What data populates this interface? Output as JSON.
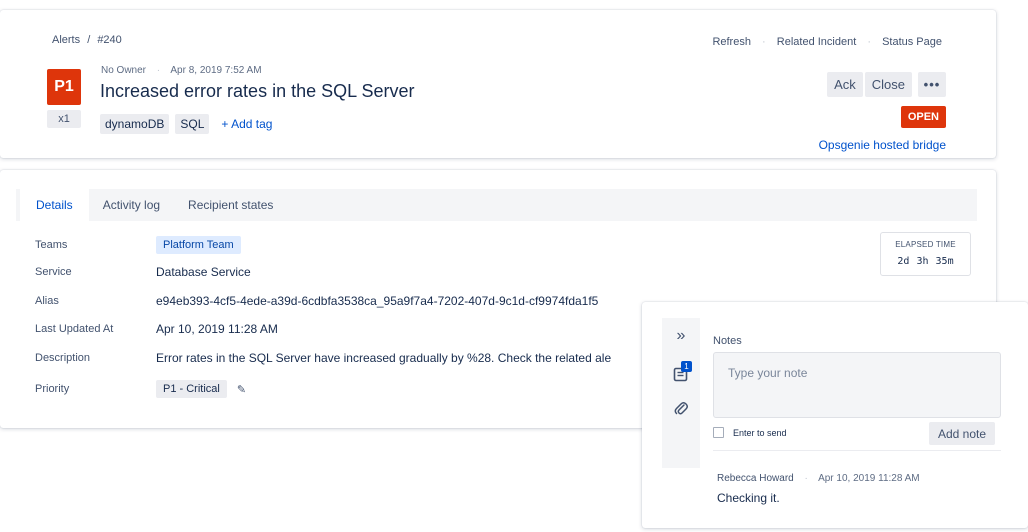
{
  "breadcrumb": {
    "section": "Alerts",
    "separator": "/",
    "alert_id": "#240"
  },
  "alert": {
    "priority": "P1",
    "count": "x1",
    "owner": "No Owner",
    "created": "Apr 8, 2019 7:52 AM",
    "title": "Increased error rates in the SQL Server",
    "tags": [
      "dynamoDB",
      "SQL"
    ],
    "add_tag_label": "+ Add tag",
    "status": "OPEN",
    "integration": "Opsgenie hosted bridge"
  },
  "top_links": {
    "refresh": "Refresh",
    "related_incident": "Related Incident",
    "status_page": "Status Page"
  },
  "actions": {
    "ack": "Ack",
    "close": "Close",
    "more": "•••"
  },
  "tabs": [
    {
      "label": "Details",
      "active": true
    },
    {
      "label": "Activity log",
      "active": false
    },
    {
      "label": "Recipient states",
      "active": false
    }
  ],
  "details": {
    "teams_label": "Teams",
    "teams_value": "Platform Team",
    "service_label": "Service",
    "service_value": "Database Service",
    "alias_label": "Alias",
    "alias_value": "e94eb393-4cf5-4ede-a39d-6cdbfa3538ca_95a9f7a4-7202-407d-9c1d-cf9974fda1f5",
    "updated_label": "Last Updated At",
    "updated_value": "Apr 10, 2019 11:28 AM",
    "description_label": "Description",
    "description_value": "Error rates in the SQL Server have increased gradually by %28. Check the related ale",
    "priority_label": "Priority",
    "priority_value": "P1 - Critical"
  },
  "elapsed": {
    "label": "ELAPSED TIME",
    "value": "2d  3h  35m"
  },
  "notes": {
    "collapse_glyph": "»",
    "notes_count": "1",
    "title": "Notes",
    "placeholder": "Type your note",
    "enter_to_send": "Enter to send",
    "add_note_label": "Add note",
    "items": [
      {
        "author": "Rebecca Howard",
        "time": "Apr 10, 2019 11:28 AM",
        "text": "Checking it."
      }
    ]
  },
  "colors": {
    "priority_red": "#de350b",
    "link_blue": "#0052cc",
    "team_badge_bg": "#deebff",
    "neutral_bg": "#ebecf0"
  }
}
